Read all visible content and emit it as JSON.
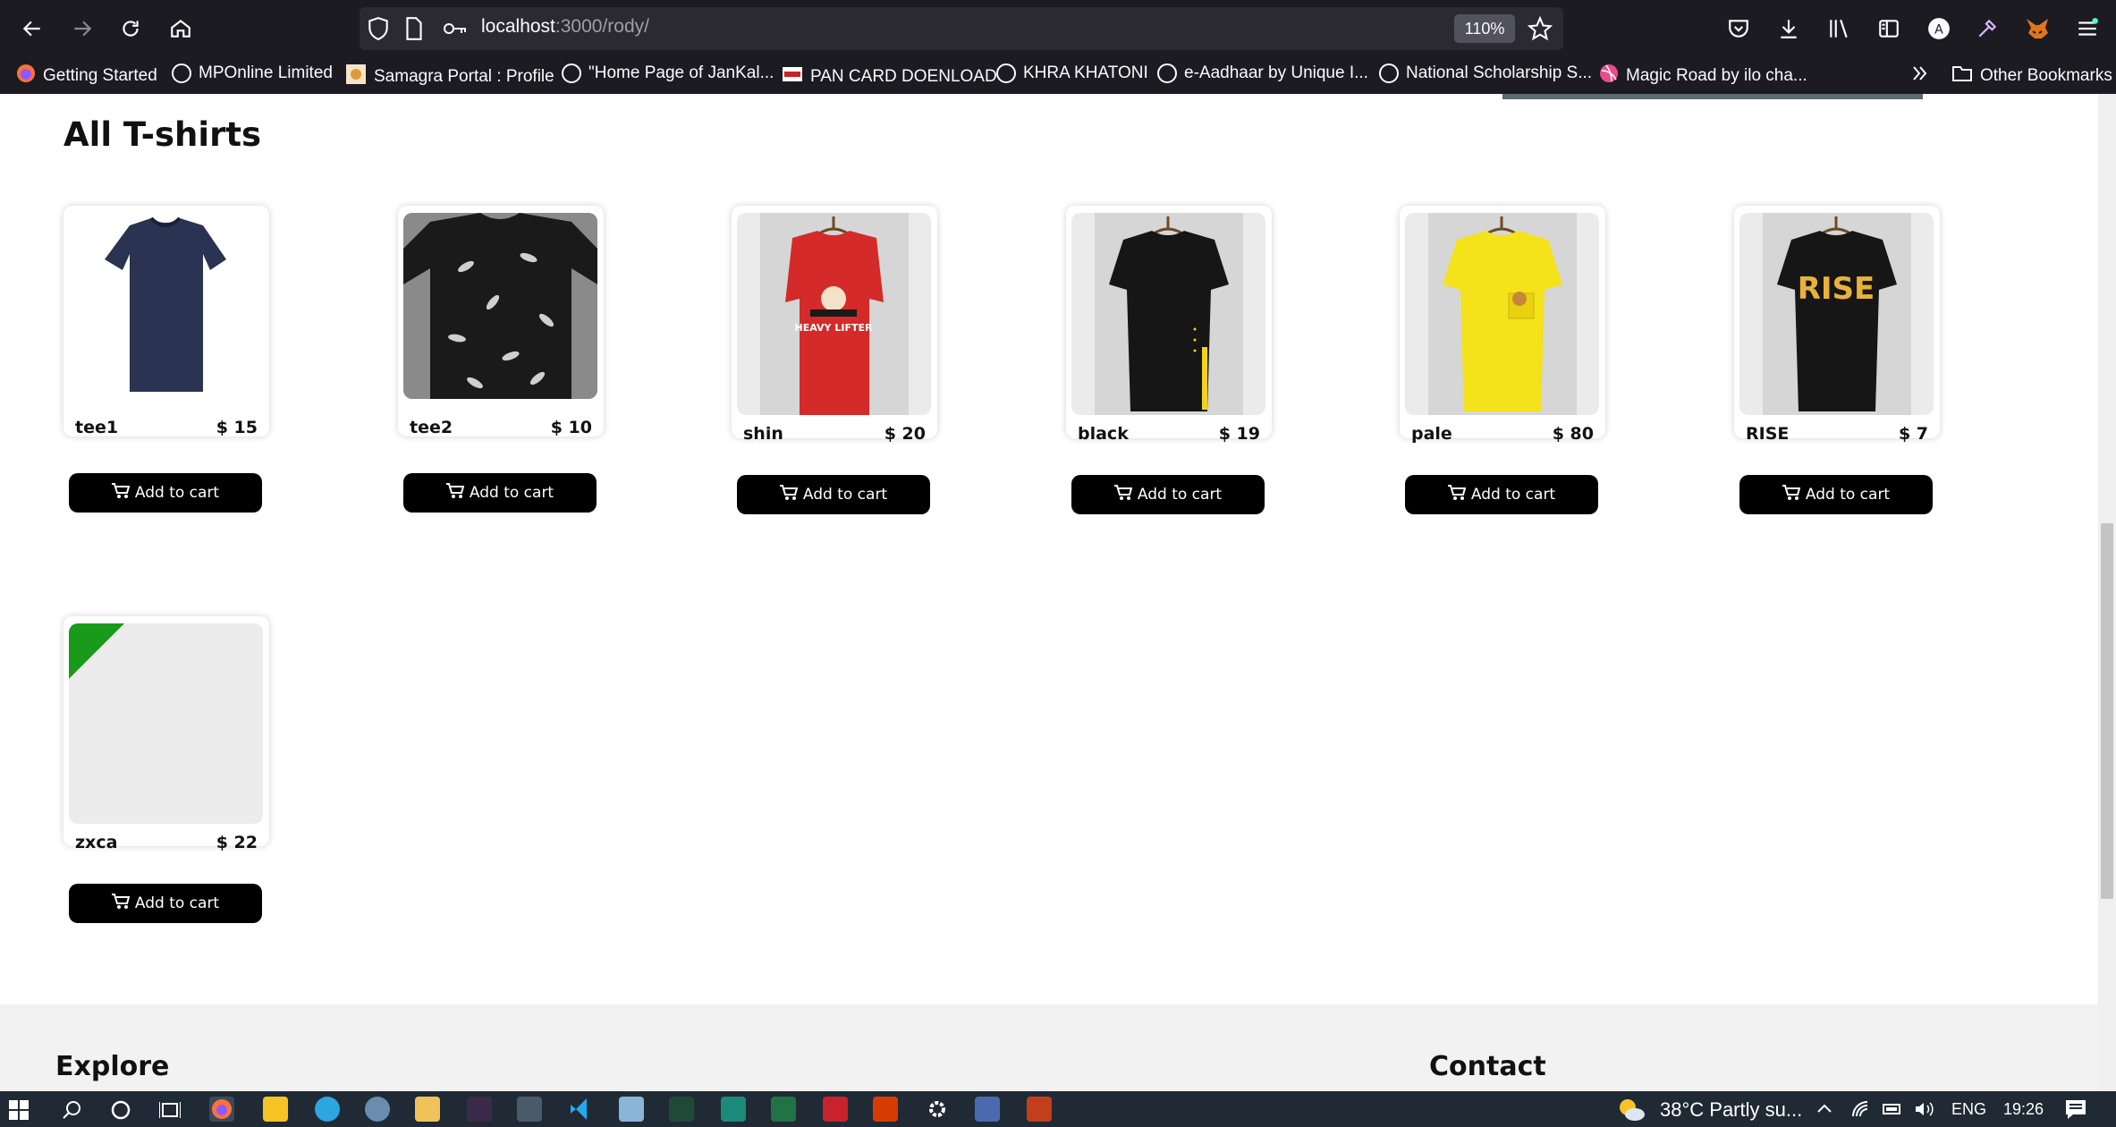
{
  "browser": {
    "url_host": "localhost",
    "url_path": ":3000/rody/",
    "zoom": "110%",
    "bookmarks": [
      {
        "label": "Getting Started",
        "icon": "firefox-icon"
      },
      {
        "label": "MPOnline Limited",
        "icon": "globe-icon"
      },
      {
        "label": "Samagra Portal : Profile",
        "icon": "samagra-icon"
      },
      {
        "label": "\"Home Page of JanKal...",
        "icon": "globe-icon"
      },
      {
        "label": "PAN CARD DOENLOAD",
        "icon": "nsdl-icon"
      },
      {
        "label": "KHRA KHATONI",
        "icon": "globe-icon"
      },
      {
        "label": "e-Aadhaar by Unique I...",
        "icon": "globe-icon"
      },
      {
        "label": "National Scholarship S...",
        "icon": "globe-icon"
      },
      {
        "label": "Magic Road by ilo cha...",
        "icon": "dribbble-icon"
      }
    ],
    "other_bookmarks": "Other Bookmarks"
  },
  "page": {
    "section_title": "All T-shirts",
    "add_to_cart_label": "Add to cart",
    "products": [
      {
        "name": "tee1",
        "price": "$ 15",
        "image": "navy-tshirt",
        "color": "#2a3352"
      },
      {
        "name": "tee2",
        "price": "$ 10",
        "image": "black-feather-tshirt",
        "color": "#1a1a1a"
      },
      {
        "name": "shin",
        "price": "$ 20",
        "image": "red-heavy-lifter-tshirt",
        "color": "#d42a2a"
      },
      {
        "name": "black",
        "price": "$ 19",
        "image": "black-stripe-tshirt",
        "color": "#161616"
      },
      {
        "name": "pale",
        "price": "$ 80",
        "image": "yellow-pocket-tshirt",
        "color": "#f4e21a"
      },
      {
        "name": "RISE",
        "price": "$ 7",
        "image": "black-rise-tshirt",
        "color": "#161616"
      },
      {
        "name": "zxca",
        "price": "$ 22",
        "image": "empty-placeholder",
        "color": "#ececec"
      }
    ],
    "tshirt_print_heavy_lifter": "HEAVY LIFTER",
    "tshirt_print_rise": "RISE"
  },
  "footer": {
    "explore": "Explore",
    "contact": "Contact"
  },
  "taskbar": {
    "weather": "38°C  Partly su...",
    "lang": "ENG",
    "time": "19:26"
  }
}
